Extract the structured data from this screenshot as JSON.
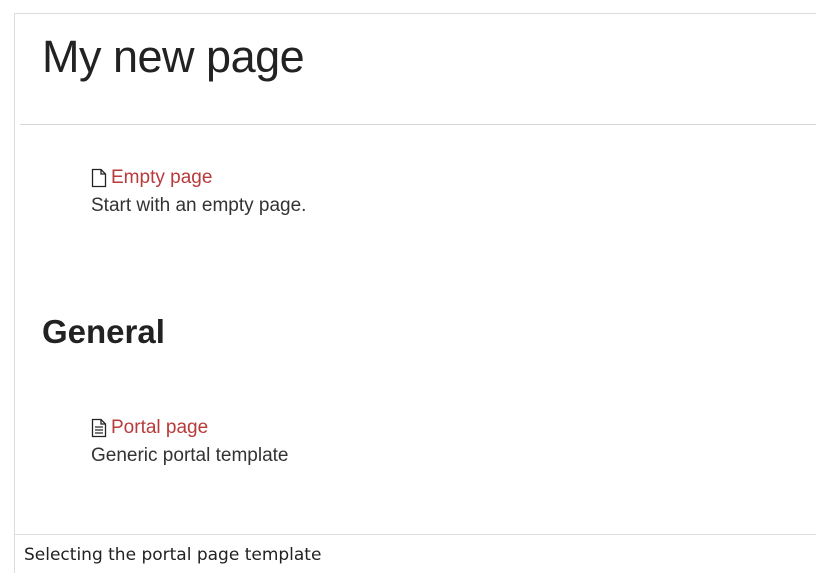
{
  "page": {
    "title": "My new page"
  },
  "templates": {
    "empty": {
      "icon": "blank-page-icon",
      "label": "Empty page",
      "description": "Start with an empty page."
    },
    "section_general": {
      "heading": "General"
    },
    "portal": {
      "icon": "text-page-icon",
      "label": "Portal page",
      "description": "Generic portal template"
    }
  },
  "caption": {
    "text": "Selecting the portal page template"
  },
  "colors": {
    "link": "#b83a3a",
    "text": "#222222",
    "divider": "#d6d6d6"
  }
}
